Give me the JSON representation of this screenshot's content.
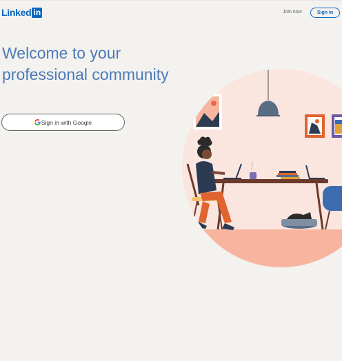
{
  "header": {
    "logo_text": "Linked",
    "logo_box": "in",
    "join_label": "Join now",
    "signin_label": "Sign in"
  },
  "main": {
    "headline": "Welcome to your professional community",
    "google_button_label": "Sign in with Google"
  },
  "icons": {
    "google": "google-g-icon",
    "hero": "remote-work-illustration"
  },
  "colors": {
    "brand_blue": "#0a66c2",
    "headline": "#4c7ab9",
    "page_bg": "#f3f2ef",
    "hero_bg": "#fbe5df",
    "hero_floor": "#f7b59f"
  }
}
